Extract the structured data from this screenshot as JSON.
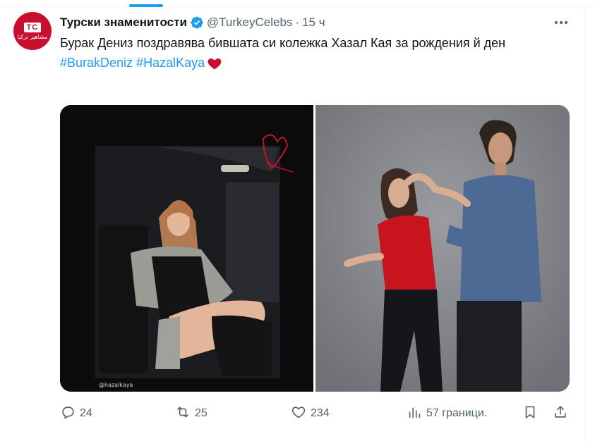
{
  "tweet": {
    "author": {
      "display_name": "Турски знаменитости",
      "handle": "@TurkeyCelebs",
      "avatar_text": "TC",
      "avatar_subtext": "مشاهير تركيا",
      "verified": true
    },
    "time": "15 ч",
    "separator": "·",
    "text": "Бурак Дениз поздравява бившата си колежка Хазал Кая за рождения й ден",
    "hashtags": [
      "#BurakDeniz",
      "#HazalKaya"
    ],
    "media": {
      "left_photo_watermark": "@hazalkaya"
    },
    "actions": {
      "replies": "24",
      "retweets": "25",
      "likes": "234",
      "views": "57 граници."
    }
  },
  "colors": {
    "accent": "#1d9bf0",
    "text_secondary": "#536471",
    "heart": "#c8102e",
    "avatar_bg": "#c8102e"
  },
  "icons": {
    "verified": "verified-badge-icon",
    "more": "more-dots-icon",
    "reply": "reply-icon",
    "retweet": "retweet-icon",
    "like": "like-heart-icon",
    "views": "views-bar-chart-icon",
    "bookmark": "bookmark-icon",
    "share": "share-icon",
    "emoji": "red-heart-emoji"
  }
}
